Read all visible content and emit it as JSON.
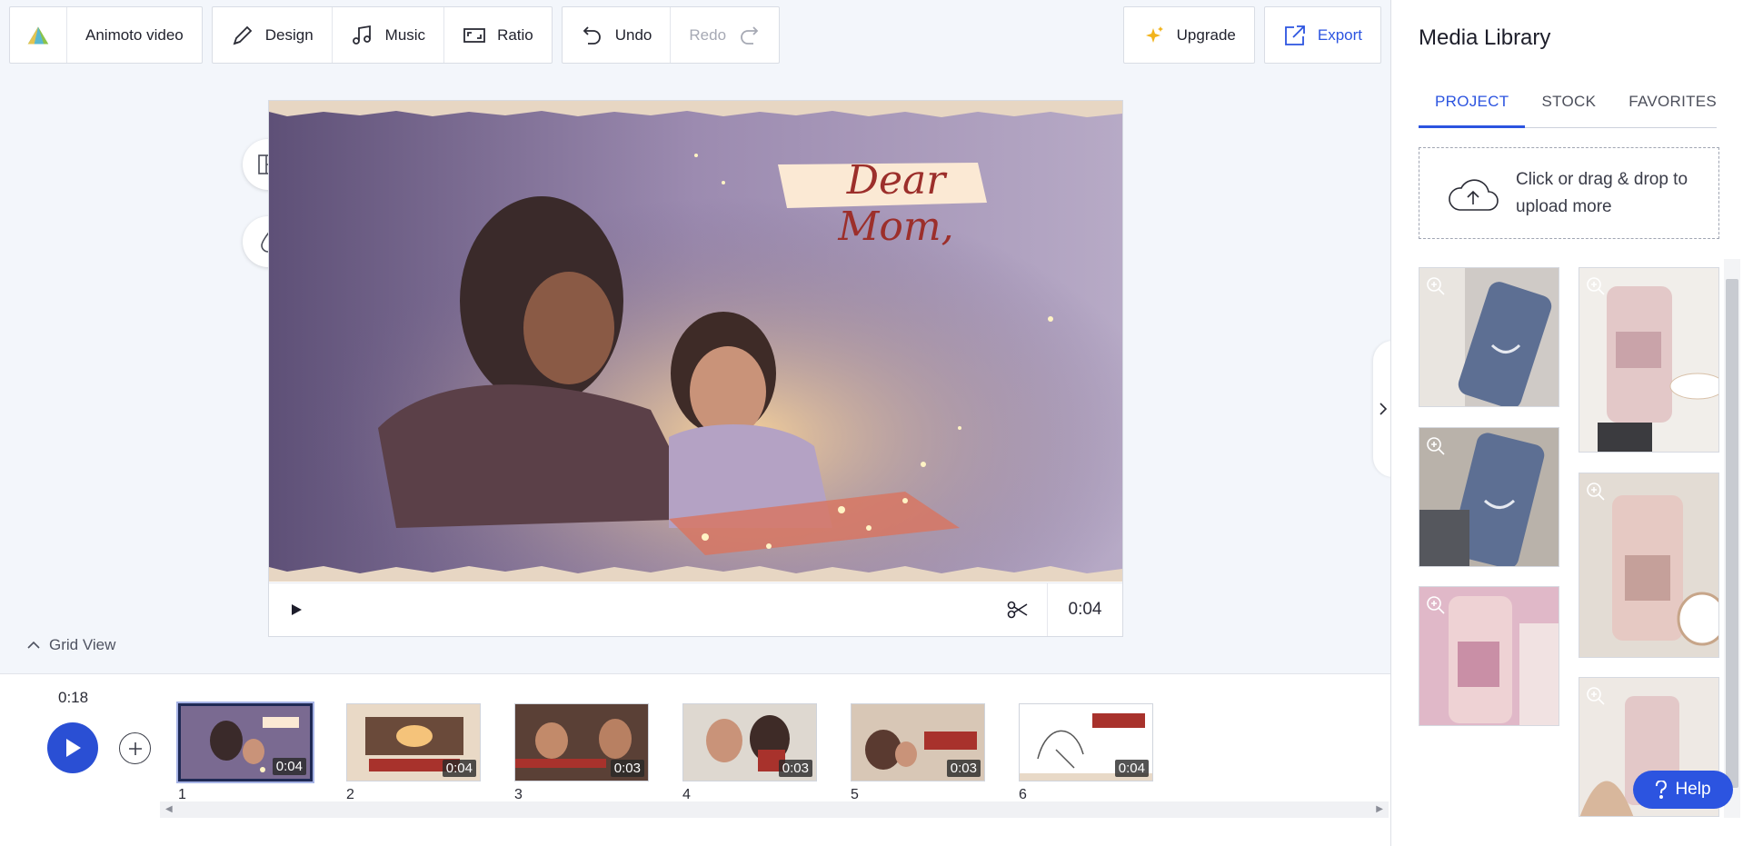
{
  "toolbar": {
    "project_name": "Animoto video",
    "design": "Design",
    "music": "Music",
    "ratio": "Ratio",
    "undo": "Undo",
    "redo": "Redo",
    "upgrade": "Upgrade",
    "export": "Export"
  },
  "preview": {
    "overlay_text": "Dear Mom,",
    "time": "0:04"
  },
  "grid_view_label": "Grid View",
  "timeline": {
    "total_time": "0:18",
    "blocks": [
      {
        "number": "1",
        "duration": "0:04",
        "selected": true
      },
      {
        "number": "2",
        "duration": "0:04",
        "selected": false
      },
      {
        "number": "3",
        "duration": "0:03",
        "selected": false
      },
      {
        "number": "4",
        "duration": "0:03",
        "selected": false
      },
      {
        "number": "5",
        "duration": "0:03",
        "selected": false
      },
      {
        "number": "6",
        "duration": "0:04",
        "selected": false
      }
    ]
  },
  "media_library": {
    "title": "Media Library",
    "tabs": [
      "PROJECT",
      "STOCK",
      "FAVORITES"
    ],
    "active_tab": "PROJECT",
    "upload_text": "Click or drag & drop to upload more"
  },
  "help_label": "Help",
  "colors": {
    "accent": "#2c54e0",
    "play": "#2a4fd4",
    "upgrade_star": "#f2b41d"
  }
}
